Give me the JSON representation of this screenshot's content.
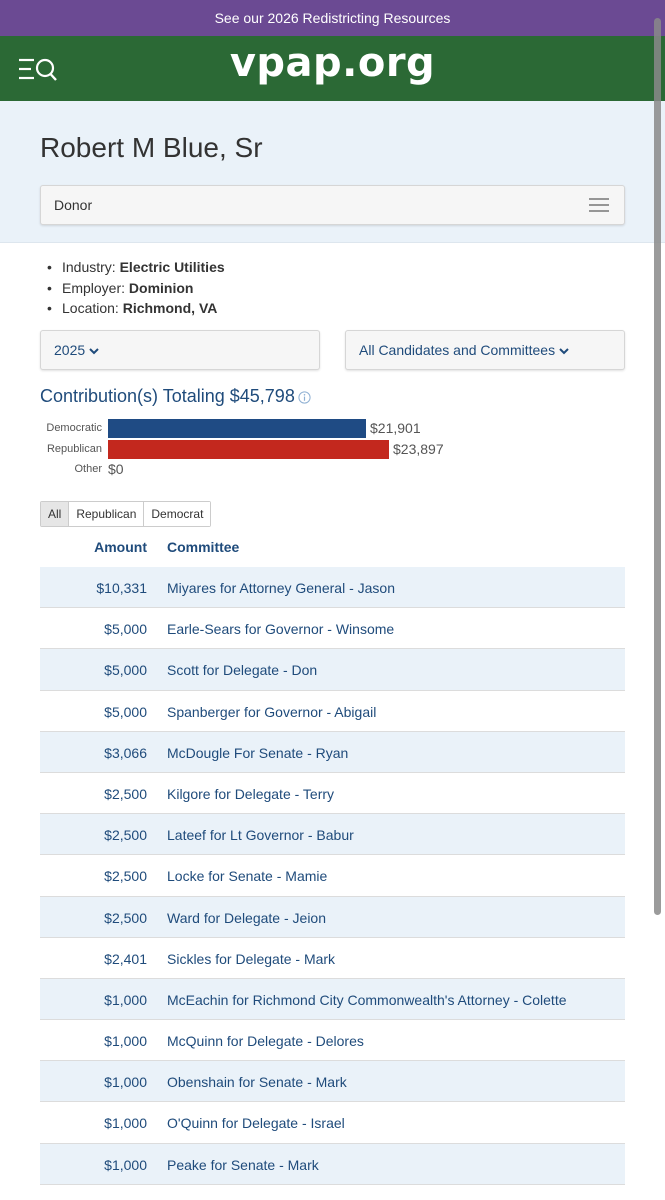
{
  "banner": {
    "text": "See our 2026 Redistricting Resources"
  },
  "header": {
    "logo": "vpap.org",
    "menu_icon": "menu-search-icon"
  },
  "page": {
    "title": "Robert M Blue, Sr",
    "role_select": "Donor"
  },
  "facts": [
    {
      "label": "Industry:",
      "value": "Electric Utilities"
    },
    {
      "label": "Employer:",
      "value": "Dominion"
    },
    {
      "label": "Location:",
      "value": "Richmond, VA"
    }
  ],
  "filters": {
    "year": "2025",
    "candidates": "All Candidates and Committees"
  },
  "summary": {
    "heading": "Contribution(s) Totaling $45,798"
  },
  "chart_data": {
    "type": "bar",
    "orientation": "horizontal",
    "categories": [
      "Democratic",
      "Republican",
      "Other"
    ],
    "values": [
      21901,
      23897,
      0
    ],
    "value_labels": [
      "$21,901",
      "$23,897",
      "$0"
    ],
    "colors": [
      "#1f4b84",
      "#c3281e",
      "#999999"
    ]
  },
  "tabs": [
    {
      "label": "All",
      "active": true
    },
    {
      "label": "Republican",
      "active": false
    },
    {
      "label": "Democrat",
      "active": false
    }
  ],
  "table": {
    "headers": {
      "amount": "Amount",
      "committee": "Committee"
    },
    "rows": [
      {
        "amount": "$10,331",
        "committee": "Miyares for Attorney General - Jason"
      },
      {
        "amount": "$5,000",
        "committee": "Earle-Sears for Governor - Winsome"
      },
      {
        "amount": "$5,000",
        "committee": "Scott for Delegate - Don"
      },
      {
        "amount": "$5,000",
        "committee": "Spanberger for Governor - Abigail"
      },
      {
        "amount": "$3,066",
        "committee": "McDougle For Senate - Ryan"
      },
      {
        "amount": "$2,500",
        "committee": "Kilgore for Delegate - Terry"
      },
      {
        "amount": "$2,500",
        "committee": "Lateef for Lt Governor - Babur"
      },
      {
        "amount": "$2,500",
        "committee": "Locke for Senate - Mamie"
      },
      {
        "amount": "$2,500",
        "committee": "Ward for Delegate - Jeion"
      },
      {
        "amount": "$2,401",
        "committee": "Sickles for Delegate - Mark"
      },
      {
        "amount": "$1,000",
        "committee": "McEachin for Richmond City Commonwealth's Attorney - Colette"
      },
      {
        "amount": "$1,000",
        "committee": "McQuinn for Delegate - Delores"
      },
      {
        "amount": "$1,000",
        "committee": "Obenshain for Senate - Mark"
      },
      {
        "amount": "$1,000",
        "committee": "O'Quinn for Delegate - Israel"
      },
      {
        "amount": "$1,000",
        "committee": "Peake for Senate - Mark"
      }
    ]
  }
}
